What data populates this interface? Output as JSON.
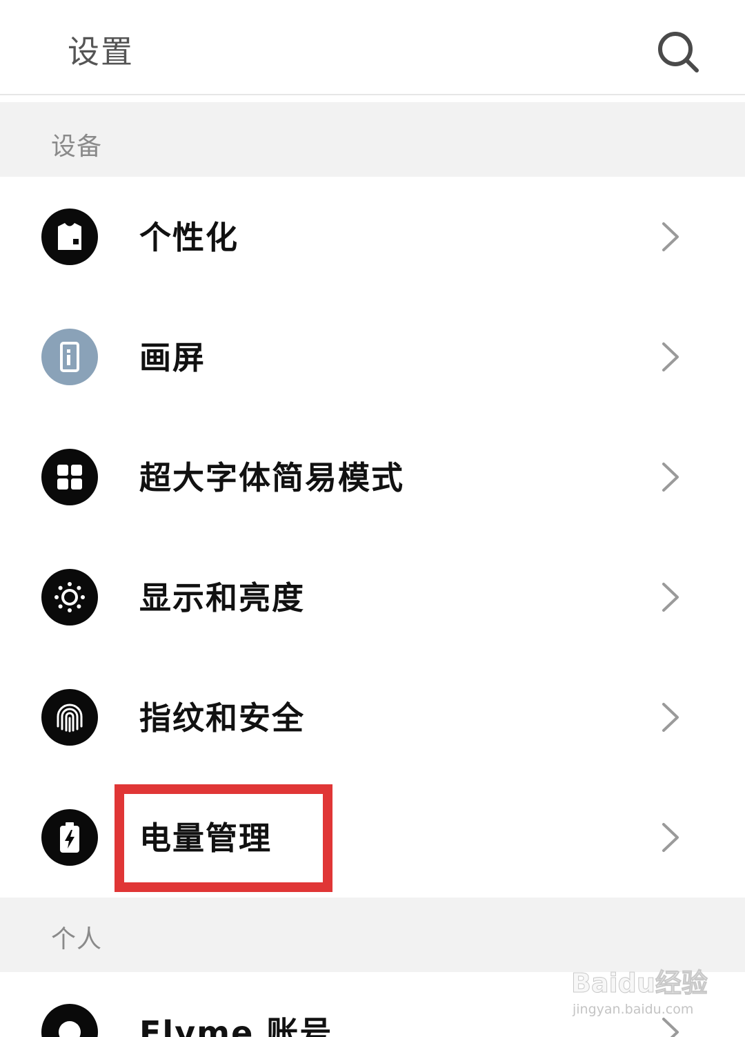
{
  "header": {
    "title": "设置",
    "search_icon": "search-icon"
  },
  "sections": {
    "device": {
      "label": "设备"
    },
    "personal": {
      "label": "个人"
    }
  },
  "items": [
    {
      "label": "个性化",
      "icon": "tshirt-icon"
    },
    {
      "label": "画屏",
      "icon": "phone-screen-icon"
    },
    {
      "label": "超大字体简易模式",
      "icon": "grid-icon"
    },
    {
      "label": "显示和亮度",
      "icon": "brightness-icon"
    },
    {
      "label": "指纹和安全",
      "icon": "fingerprint-icon"
    },
    {
      "label": "电量管理",
      "icon": "battery-icon"
    },
    {
      "label": "Flyme 账号",
      "icon": "account-icon"
    }
  ],
  "watermark": {
    "main": "Baidu经验",
    "sub": "jingyan.baidu.com"
  },
  "colors": {
    "icon_dark": "#0a0a0a",
    "icon_blue": "#8aa2b8",
    "highlight": "#e03636",
    "section_bg": "#f2f2f2"
  }
}
